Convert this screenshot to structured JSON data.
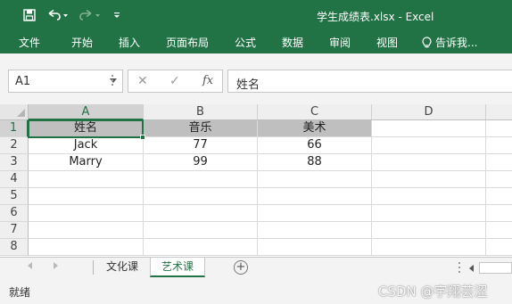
{
  "window": {
    "title": "学生成绩表.xlsx - Excel",
    "accent": "#217346"
  },
  "ribbon": {
    "tabs": [
      "文件",
      "开始",
      "插入",
      "页面布局",
      "公式",
      "数据",
      "审阅",
      "视图"
    ],
    "tell_me": "告诉我..."
  },
  "formula_bar": {
    "name_box": "A1",
    "cancel_symbol": "✕",
    "enter_symbol": "✓",
    "fx_symbol": "fx",
    "content": "姓名"
  },
  "grid": {
    "columns": [
      "A",
      "B",
      "C",
      "D"
    ],
    "row_numbers": [
      "1",
      "2",
      "3",
      "4",
      "5",
      "6",
      "7",
      "8"
    ],
    "active_cell": "A1",
    "header_fill": "#bfbfbf",
    "rows": [
      [
        "姓名",
        "音乐",
        "美术"
      ],
      [
        "Jack",
        "77",
        "66"
      ],
      [
        "Marry",
        "99",
        "88"
      ]
    ]
  },
  "sheet_tabs": {
    "tabs": [
      "文化课",
      "艺术课"
    ],
    "active": "艺术课"
  },
  "status_bar": {
    "status": "就绪",
    "watermark": "CSDN @宇翔芸涩"
  }
}
